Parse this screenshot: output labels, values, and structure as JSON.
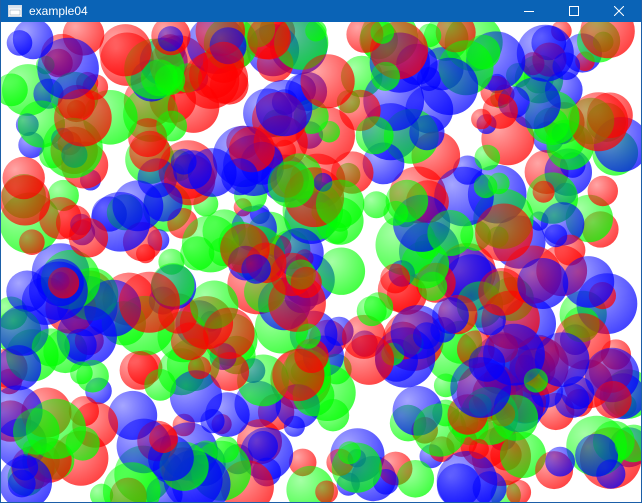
{
  "window": {
    "title": "example04",
    "icon": "app-window-icon",
    "controls": {
      "minimize_icon": "minimize-icon",
      "maximize_icon": "maximize-icon",
      "close_icon": "close-icon"
    }
  },
  "colors": {
    "titlebar": "#0a63b6",
    "red": "#ff0000",
    "green": "#00ff00",
    "blue": "#0000ff",
    "background": "#ffffff"
  },
  "scene": {
    "description_type": "random-translucent-circles",
    "color_names": [
      "red",
      "green",
      "blue"
    ]
  }
}
